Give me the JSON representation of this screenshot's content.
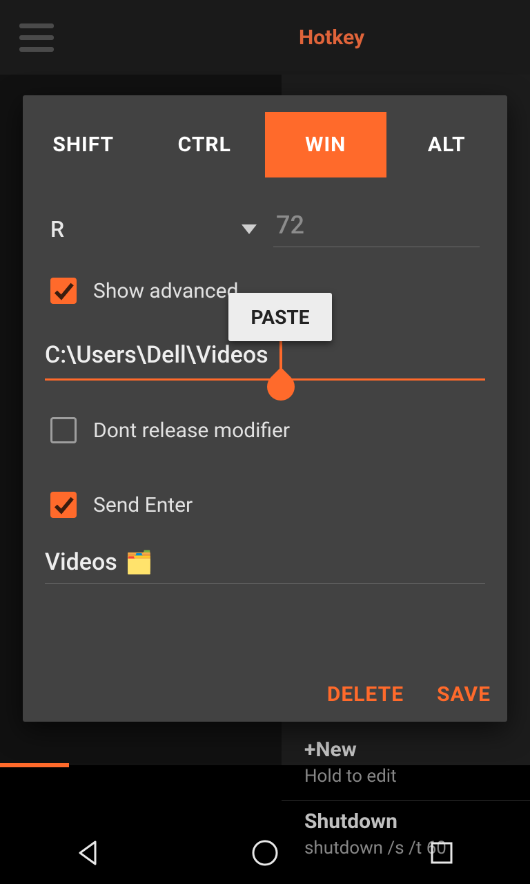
{
  "header": {
    "title": "Hotkey"
  },
  "dialog": {
    "modifiers": {
      "shift": "SHIFT",
      "ctrl": "CTRL",
      "win": "WIN",
      "alt": "ALT",
      "active": "win"
    },
    "key_letter": "R",
    "key_code": "72",
    "show_advanced": {
      "label": "Show advanced",
      "checked": true
    },
    "path_value": "C:\\Users\\Dell\\Videos",
    "dont_release": {
      "label": "Dont release modifier",
      "checked": false
    },
    "send_enter": {
      "label": "Send Enter",
      "checked": true
    },
    "name_value": "Videos",
    "paste_label": "PASTE",
    "delete_label": "DELETE",
    "save_label": "SAVE"
  },
  "right_panel": {
    "new": {
      "title": "+New",
      "subtitle": "Hold to edit"
    },
    "shutdown": {
      "title": "Shutdown",
      "subtitle": "shutdown /s /t 60"
    }
  },
  "colors": {
    "accent": "#ff6a2b"
  }
}
